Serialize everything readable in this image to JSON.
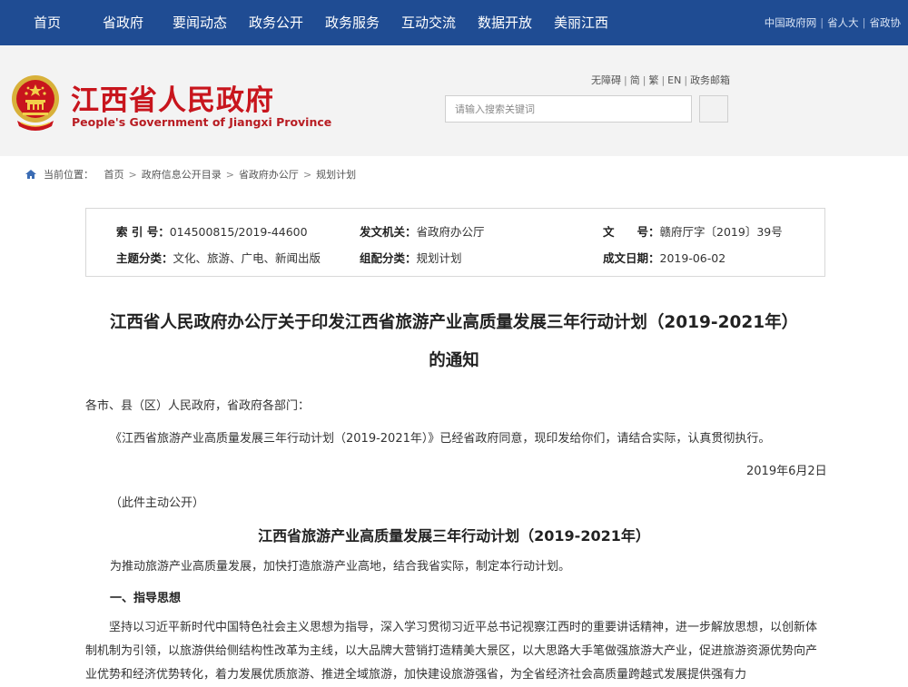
{
  "nav": {
    "items": [
      "首页",
      "省政府",
      "要闻动态",
      "政务公开",
      "政务服务",
      "互动交流",
      "数据开放",
      "美丽江西"
    ],
    "right_links": [
      "中国政府网",
      "省人大",
      "省政协"
    ],
    "bg_color": "#1f4c93"
  },
  "header": {
    "emblem_icon": "national-emblem-icon",
    "title": "江西省人民政府",
    "subtitle": "People's Government of Jiangxi Province",
    "quick_links": [
      "无障碍",
      "简",
      "繁",
      "EN",
      "政务邮箱"
    ],
    "search": {
      "placeholder": "请输入搜索关键词"
    },
    "title_color": "#c8151d"
  },
  "breadcrumb": {
    "label": "当前位置：",
    "items": [
      "首页",
      "政府信息公开目录",
      "省政府办公厅",
      "规划计划"
    ]
  },
  "info": {
    "index_label": "索 引 号：",
    "index_value": "014500815/2019-44600",
    "issuer_label": "发文机关：",
    "issuer_value": "省政府办公厅",
    "docno_label": "文　　号：",
    "docno_value": "赣府厅字〔2019〕39号",
    "topic_label": "主题分类：",
    "topic_value": "文化、旅游、广电、新闻出版",
    "category_label": "组配分类：",
    "category_value": "规划计划",
    "date_label": "成文日期：",
    "date_value": "2019-06-02"
  },
  "article": {
    "title_line1": "江西省人民政府办公厅关于印发江西省旅游产业高质量发展三年行动计划（2019-2021年）",
    "title_line2": "的通知",
    "salutation": "各市、县（区）人民政府，省政府各部门：",
    "body1": "《江西省旅游产业高质量发展三年行动计划（2019-2021年）》已经省政府同意，现印发给你们，请结合实际，认真贯彻执行。",
    "date": "2019年6月2日",
    "public_note": "（此件主动公开）",
    "plan_title": "江西省旅游产业高质量发展三年行动计划（2019-2021年）",
    "intro": "为推动旅游产业高质量发展，加快打造旅游产业高地，结合我省实际，制定本行动计划。",
    "section1": "一、指导思想",
    "section1_body": "坚持以习近平新时代中国特色社会主义思想为指导，深入学习贯彻习近平总书记视察江西时的重要讲话精神，进一步解放思想，以创新体制机制为引领，以旅游供给侧结构性改革为主线，以大品牌大营销打造精美大景区，以大思路大手笔做强旅游大产业，促进旅游资源优势向产业优势和经济优势转化，着力发展优质旅游、推进全域旅游，加快建设旅游强省，为全省经济社会高质量跨越式发展提供强有力"
  }
}
